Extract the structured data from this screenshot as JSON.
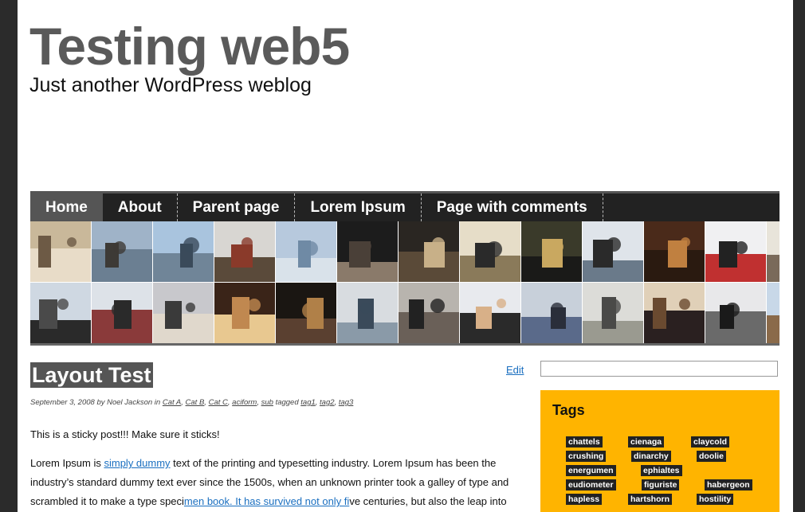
{
  "site": {
    "title": "Testing web5",
    "tagline": "Just another WordPress weblog"
  },
  "nav": [
    {
      "label": "Home",
      "active": true
    },
    {
      "label": "About"
    },
    {
      "label": "Parent page"
    },
    {
      "label": "Lorem Ipsum"
    },
    {
      "label": "Page with comments"
    }
  ],
  "post": {
    "title": "Layout Test",
    "edit_label": "Edit",
    "meta": {
      "date_author": "September 3, 2008 by Noel Jackson in",
      "categories": [
        "Cat A",
        "Cat B",
        "Cat C",
        "aciform",
        "sub"
      ],
      "tagged_label": "tagged",
      "tags": [
        "tag1",
        "tag2",
        "tag3"
      ]
    },
    "sticky_text": "This is a sticky post!!! Make sure it sticks!",
    "body": {
      "prefix": "Lorem Ipsum is ",
      "link1": "simply dummy",
      "middle": " text of the printing and typesetting industry. Lorem Ipsum has been the industry’s standard dummy text ever since the 1500s, when an unknown printer took a galley of type and scrambled it to make a type speci",
      "link2": "men book. It has survived not only fi",
      "suffix": "ve centuries, but also the leap into"
    }
  },
  "sidebar": {
    "search_value": "",
    "tags_title": "Tags",
    "tag_cloud": [
      "chattels",
      "cienaga",
      "claycold",
      "crushing",
      "dinarchy",
      "doolie",
      "energumen",
      "ephialtes",
      "eudiometer",
      "figuriste",
      "habergeon",
      "hapless",
      "hartshorn",
      "hostility"
    ]
  },
  "colors": {
    "nav_bg": "#222222",
    "nav_active": "#555555",
    "tags_bg": "#ffb400",
    "link": "#1a6fc0"
  }
}
